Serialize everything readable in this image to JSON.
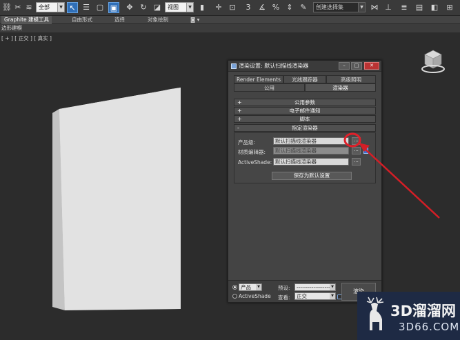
{
  "toolbar": {
    "selection_filter": "全部",
    "reference_coord": "视图",
    "named_selection": "创建选择集"
  },
  "ribbon": {
    "tabs": [
      "Graphite 建模工具",
      "自由形式",
      "选择",
      "对象绘制"
    ],
    "panel_label": "边形建模"
  },
  "viewport": {
    "label": "[ + ] [ 正交 ] [ 真实 ]"
  },
  "dialog": {
    "title": "渲染设置: 默认扫描线渲染器",
    "tabs_row1": [
      "Render Elements",
      "光线跟踪器",
      "高级照明"
    ],
    "tabs_row2": [
      "公用",
      "渲染器"
    ],
    "rollouts": [
      {
        "sign": "+",
        "label": "公用参数"
      },
      {
        "sign": "+",
        "label": "电子邮件通知"
      },
      {
        "sign": "+",
        "label": "脚本"
      },
      {
        "sign": "-",
        "label": "指定渲染器"
      }
    ],
    "assign": {
      "production_label": "产品级:",
      "production_value": "默认扫描线渲染器",
      "material_label": "材质编辑器:",
      "material_value": "默认扫描线渲染器",
      "activeshade_label": "ActiveShade:",
      "activeshade_value": "默认扫描线渲染器",
      "dots": "...",
      "save_default": "保存为默认设置"
    },
    "bottom": {
      "mode_product": "产品",
      "mode_activeshade": "ActiveShade",
      "preset_label": "预设:",
      "preset_value": "-------------------",
      "view_label": "查看:",
      "view_value": "正交",
      "render_button": "渲染"
    }
  },
  "watermark": {
    "brand": "3D溜溜网",
    "domain": "3D66.COM"
  },
  "colors": {
    "highlight_circle": "#e0202a",
    "arrow": "#d41e26",
    "active_tool": "#2f6fb8"
  }
}
